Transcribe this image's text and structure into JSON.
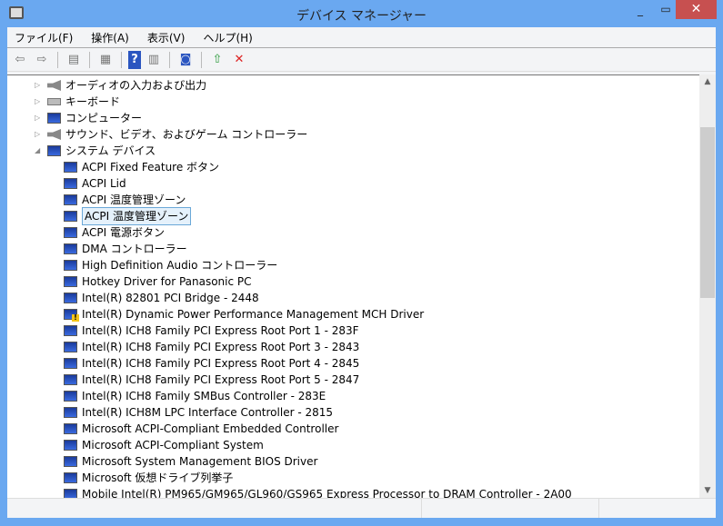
{
  "window": {
    "title": "デバイス マネージャー",
    "minimize": "_",
    "maximize": "▭",
    "close": "✕"
  },
  "menu": [
    "ファイル(F)",
    "操作(A)",
    "表示(V)",
    "ヘルプ(H)"
  ],
  "categories": [
    {
      "label": "オーディオの入力および出力",
      "icon": "speaker-icon",
      "expanded": false
    },
    {
      "label": "キーボード",
      "icon": "keyboard-icon",
      "expanded": false
    },
    {
      "label": "コンピューター",
      "icon": "computer-icon",
      "expanded": false
    },
    {
      "label": "サウンド、ビデオ、およびゲーム コントローラー",
      "icon": "speaker-icon",
      "expanded": false
    },
    {
      "label": "システム デバイス",
      "icon": "computer-icon",
      "expanded": true
    }
  ],
  "devices": [
    "ACPI Fixed Feature ボタン",
    "ACPI Lid",
    "ACPI 温度管理ゾーン",
    "ACPI 温度管理ゾーン",
    "ACPI 電源ボタン",
    "DMA コントローラー",
    "High Definition Audio コントローラー",
    "Hotkey Driver for Panasonic PC",
    "Intel(R) 82801 PCI Bridge - 2448",
    "Intel(R) Dynamic Power Performance Management MCH Driver",
    "Intel(R) ICH8 Family PCI Express Root Port 1 - 283F",
    "Intel(R) ICH8 Family PCI Express Root Port 3 - 2843",
    "Intel(R) ICH8 Family PCI Express Root Port 4 - 2845",
    "Intel(R) ICH8 Family PCI Express Root Port 5 - 2847",
    "Intel(R) ICH8 Family SMBus Controller - 283E",
    "Intel(R) ICH8M LPC Interface Controller - 2815",
    "Microsoft ACPI-Compliant Embedded Controller",
    "Microsoft ACPI-Compliant System",
    "Microsoft System Management BIOS Driver",
    "Microsoft 仮想ドライブ列挙子",
    "Mobile Intel(R) PM965/GM965/GL960/GS965 Express Processor to DRAM Controller - 2A00"
  ],
  "selected_index": 3,
  "warning_index": 9
}
